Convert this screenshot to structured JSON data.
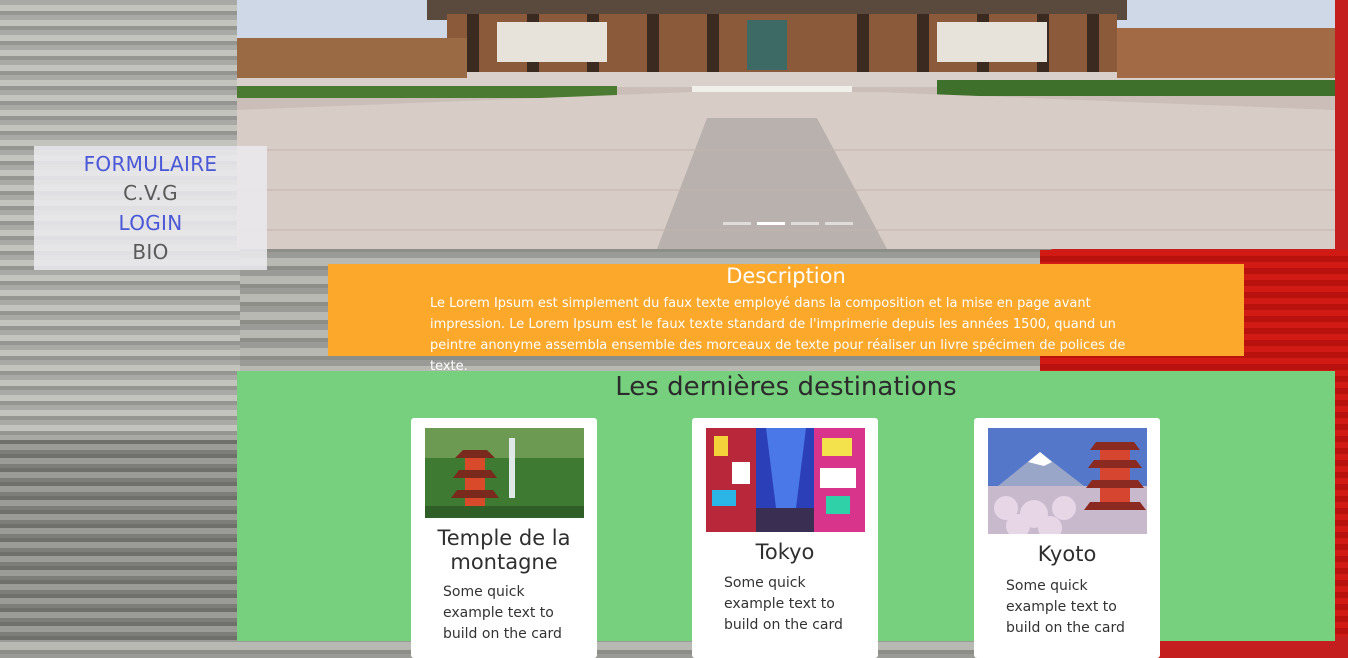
{
  "nav": {
    "items": [
      {
        "label": "FORMULAIRE"
      },
      {
        "label": "C.V.G"
      },
      {
        "label": "LOGIN"
      },
      {
        "label": "BIO"
      }
    ]
  },
  "description": {
    "title": "Description",
    "text": "Le Lorem Ipsum est simplement du faux texte employé dans la composition et la mise en page avant impression. Le Lorem Ipsum est le faux texte standard de l'imprimerie depuis les années 1500, quand un peintre anonyme assembla ensemble des morceaux de texte pour réaliser un livre spécimen de polices de texte."
  },
  "destinations": {
    "title": "Les dernières destinations",
    "cards": [
      {
        "title": "Temple de la montagne",
        "text": "Some quick example text to build on the card"
      },
      {
        "title": "Tokyo",
        "text": "Some quick example text to build on the card"
      },
      {
        "title": "Kyoto",
        "text": "Some quick example text to build on the card"
      }
    ]
  },
  "colors": {
    "description_bg": "#fca82b",
    "destinations_bg": "#77d07e",
    "nav_link": "#4a57d6"
  }
}
